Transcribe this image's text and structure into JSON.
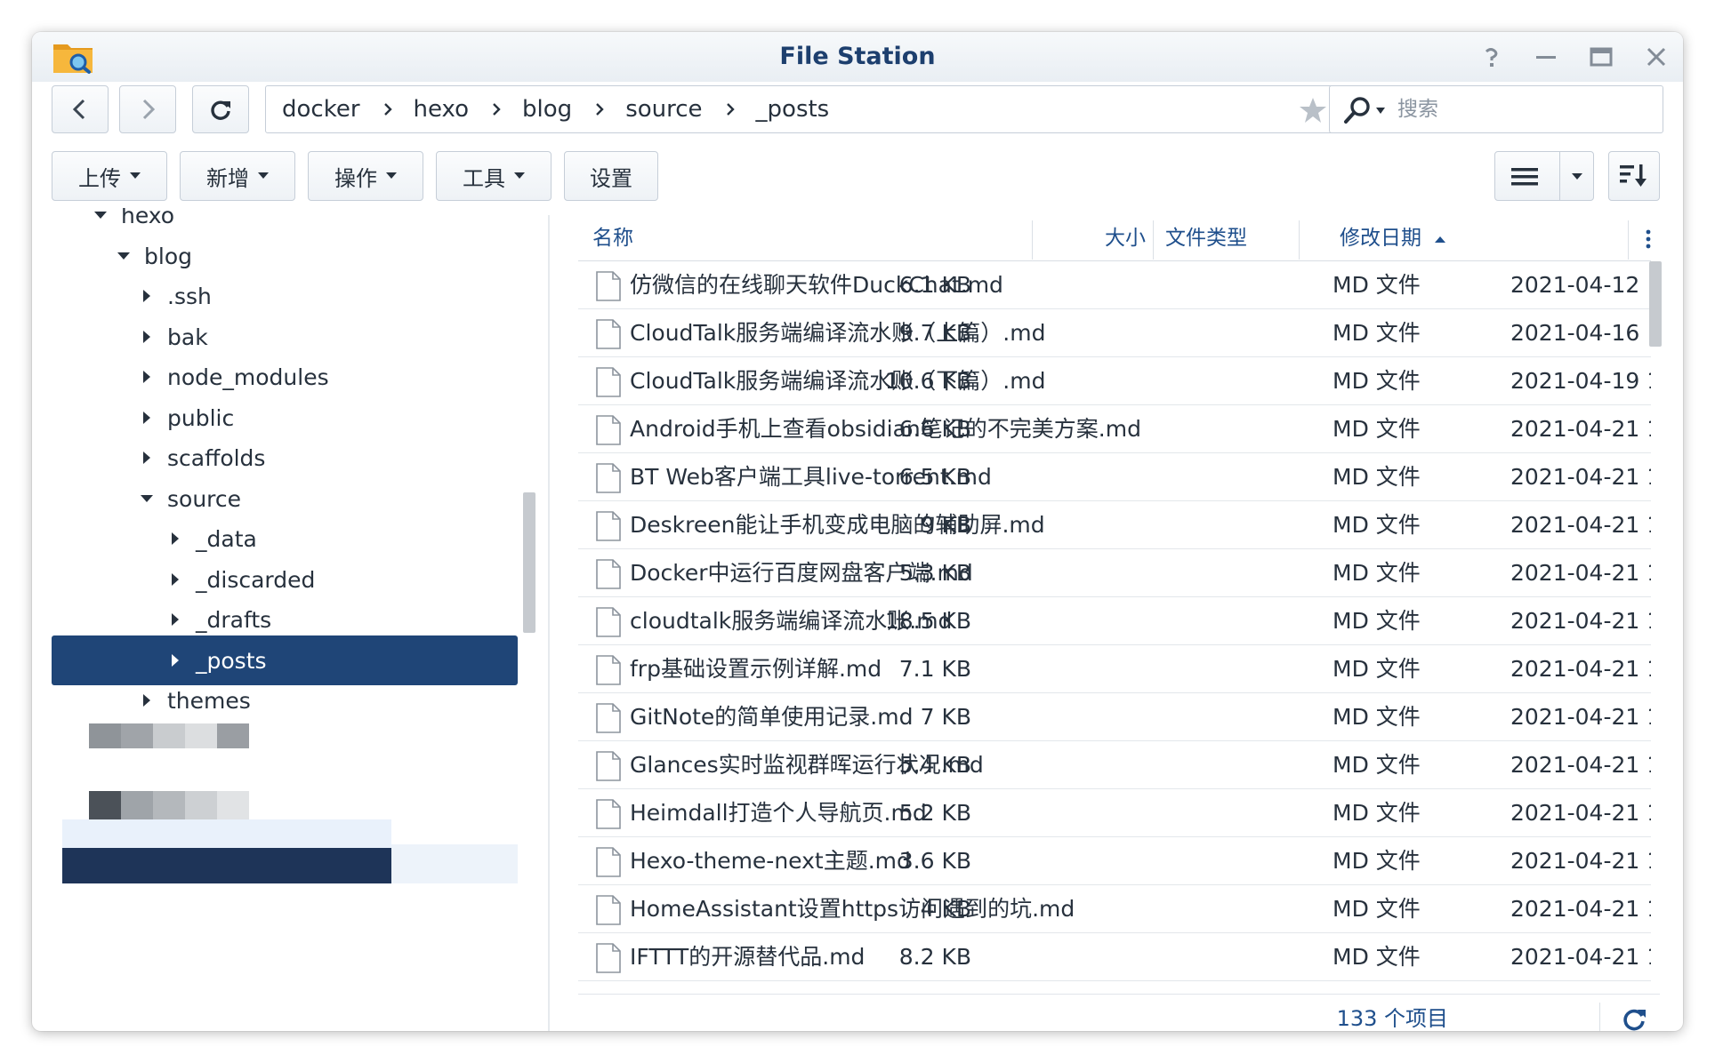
{
  "window": {
    "title": "File Station"
  },
  "path": {
    "crumbs": [
      "docker",
      "hexo",
      "blog",
      "source",
      "_posts"
    ]
  },
  "search": {
    "placeholder": "搜索"
  },
  "toolbar": {
    "upload_label": "上传",
    "create_label": "新增",
    "action_label": "操作",
    "tools_label": "工具",
    "settings_label": "设置"
  },
  "tree": {
    "items": [
      {
        "label": "hexo",
        "expanded": true
      },
      {
        "label": "blog",
        "expanded": true
      },
      {
        "label": ".ssh",
        "expanded": false
      },
      {
        "label": "bak",
        "expanded": false
      },
      {
        "label": "node_modules",
        "expanded": false
      },
      {
        "label": "public",
        "expanded": false
      },
      {
        "label": "scaffolds",
        "expanded": false
      },
      {
        "label": "source",
        "expanded": true
      },
      {
        "label": "_data",
        "expanded": false
      },
      {
        "label": "_discarded",
        "expanded": false
      },
      {
        "label": "_drafts",
        "expanded": false
      },
      {
        "label": "_posts",
        "expanded": false,
        "selected": true
      },
      {
        "label": "themes",
        "expanded": false
      }
    ]
  },
  "list": {
    "headers": {
      "name": "名称",
      "size": "大小",
      "type": "文件类型",
      "modified": "修改日期"
    },
    "rows": [
      {
        "name": "仿微信的在线聊天软件DuckChat.md",
        "size": "6.1 KB",
        "type": "MD 文件",
        "modified": "2021-04-12 1..."
      },
      {
        "name": "CloudTalk服务端编译流水账（上篇）.md",
        "size": "9.7 KB",
        "type": "MD 文件",
        "modified": "2021-04-16 1..."
      },
      {
        "name": "CloudTalk服务端编译流水账（下篇）.md",
        "size": "10.6 KB",
        "type": "MD 文件",
        "modified": "2021-04-19 1..."
      },
      {
        "name": "Android手机上查看obsidian笔记的不完美方案.md",
        "size": "6.6 KB",
        "type": "MD 文件",
        "modified": "2021-04-21 1..."
      },
      {
        "name": "BT Web客户端工具live-torrent.md",
        "size": "6.5 KB",
        "type": "MD 文件",
        "modified": "2021-04-21 1..."
      },
      {
        "name": "Deskreen能让手机变成电脑的辅助屏.md",
        "size": "9 KB",
        "type": "MD 文件",
        "modified": "2021-04-21 1..."
      },
      {
        "name": "Docker中运行百度网盘客户端.md",
        "size": "5.3 KB",
        "type": "MD 文件",
        "modified": "2021-04-21 1..."
      },
      {
        "name": "cloudtalk服务端编译流水账.md",
        "size": "18.5 KB",
        "type": "MD 文件",
        "modified": "2021-04-21 1..."
      },
      {
        "name": "frp基础设置示例详解.md",
        "size": "7.1 KB",
        "type": "MD 文件",
        "modified": "2021-04-21 1..."
      },
      {
        "name": "GitNote的简单使用记录.md",
        "size": "7 KB",
        "type": "MD 文件",
        "modified": "2021-04-21 1..."
      },
      {
        "name": "Glances实时监视群晖运行状况.md",
        "size": "5.4 KB",
        "type": "MD 文件",
        "modified": "2021-04-21 1..."
      },
      {
        "name": "Heimdall打造个人导航页.md",
        "size": "5.2 KB",
        "type": "MD 文件",
        "modified": "2021-04-21 1..."
      },
      {
        "name": "Hexo-theme-next主题.md",
        "size": "3.6 KB",
        "type": "MD 文件",
        "modified": "2021-04-21 1..."
      },
      {
        "name": "HomeAssistant设置https访问遇到的坑.md",
        "size": "4 KB",
        "type": "MD 文件",
        "modified": "2021-04-21 1..."
      },
      {
        "name": "IFTTT的开源替代品.md",
        "size": "8.2 KB",
        "type": "MD 文件",
        "modified": "2021-04-21 1..."
      }
    ]
  },
  "status": {
    "item_count": "133 个项目"
  },
  "colors": {
    "accent": "#1f4577",
    "header_text": "#1f4f8c",
    "title_text": "#1d3f6e"
  }
}
